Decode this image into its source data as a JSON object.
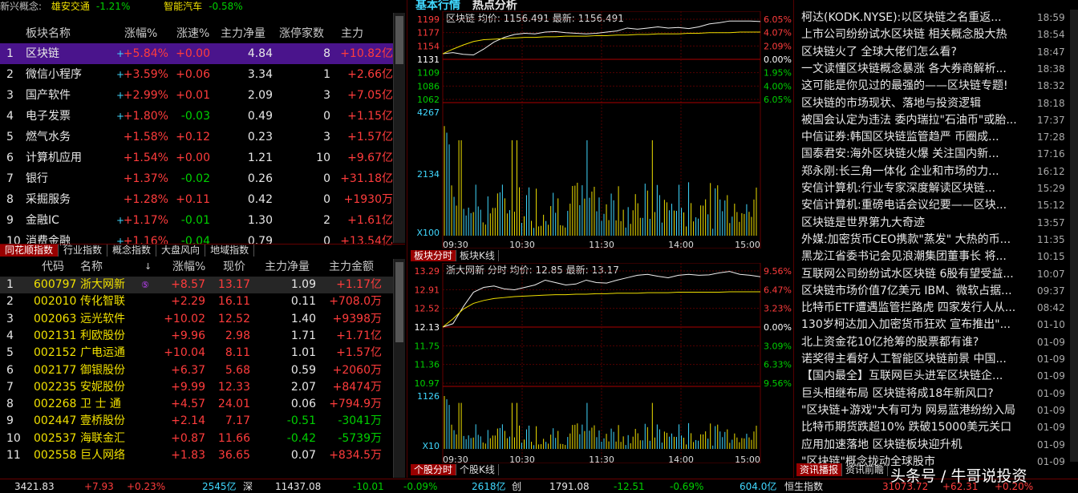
{
  "ticker": {
    "label": "新兴概念:",
    "items": [
      {
        "name": "雄安交通",
        "pct": "-1.21%"
      },
      {
        "name": "智能汽车",
        "pct": "-0.58%"
      }
    ]
  },
  "sector_table": {
    "headers": [
      "板块名称",
      "涨幅%",
      "涨速%",
      "主力净量",
      "涨停家数",
      "主力"
    ],
    "rows": [
      {
        "no": "1",
        "name": "区块链",
        "flag": "+",
        "chg": "+5.84%",
        "spd": "+0.00",
        "net": "4.84",
        "lim": "8",
        "amt": "+10.82亿"
      },
      {
        "no": "2",
        "name": "微信小程序",
        "flag": "+",
        "chg": "+3.59%",
        "spd": "+0.06",
        "net": "3.34",
        "lim": "1",
        "amt": "+2.66亿"
      },
      {
        "no": "3",
        "name": "国产软件",
        "flag": "+",
        "chg": "+2.99%",
        "spd": "+0.01",
        "net": "2.09",
        "lim": "3",
        "amt": "+7.05亿"
      },
      {
        "no": "4",
        "name": "电子发票",
        "flag": "+",
        "chg": "+1.80%",
        "spd": "-0.03",
        "net": "0.49",
        "lim": "0",
        "amt": "+1.15亿"
      },
      {
        "no": "5",
        "name": "燃气水务",
        "flag": "",
        "chg": "+1.58%",
        "spd": "+0.12",
        "net": "0.23",
        "lim": "3",
        "amt": "+1.57亿"
      },
      {
        "no": "6",
        "name": "计算机应用",
        "flag": "",
        "chg": "+1.54%",
        "spd": "+0.00",
        "net": "1.21",
        "lim": "10",
        "amt": "+9.67亿"
      },
      {
        "no": "7",
        "name": "银行",
        "flag": "",
        "chg": "+1.37%",
        "spd": "-0.02",
        "net": "0.26",
        "lim": "0",
        "amt": "+31.18亿"
      },
      {
        "no": "8",
        "name": "采掘服务",
        "flag": "",
        "chg": "+1.28%",
        "spd": "+0.11",
        "net": "0.42",
        "lim": "0",
        "amt": "+1930万"
      },
      {
        "no": "9",
        "name": "金融IC",
        "flag": "+",
        "chg": "+1.17%",
        "spd": "-0.01",
        "net": "1.30",
        "lim": "2",
        "amt": "+1.61亿"
      },
      {
        "no": "10",
        "name": "消费金融",
        "flag": "+",
        "chg": "+1.16%",
        "spd": "-0.04",
        "net": "0.79",
        "lim": "0",
        "amt": "+13.54亿"
      }
    ]
  },
  "left_tabs": [
    "同花顺指数",
    "行业指数",
    "概念指数",
    "大盘风向",
    "地域指数"
  ],
  "stock_table": {
    "headers": [
      "代码",
      "名称",
      "涨幅%",
      "现价",
      "主力净量",
      "主力金额"
    ],
    "rows": [
      {
        "no": "1",
        "code": "600797",
        "name": "浙大网新",
        "chg": "+8.57",
        "price": "13.17",
        "net": "1.09",
        "amt": "+1.17亿"
      },
      {
        "no": "2",
        "code": "002010",
        "name": "传化智联",
        "chg": "+2.29",
        "price": "16.11",
        "net": "0.11",
        "amt": "+708.0万"
      },
      {
        "no": "3",
        "code": "002063",
        "name": "远光软件",
        "chg": "+10.02",
        "price": "12.52",
        "net": "1.40",
        "amt": "+9398万"
      },
      {
        "no": "4",
        "code": "002131",
        "name": "利欧股份",
        "chg": "+9.96",
        "price": "2.98",
        "net": "1.71",
        "amt": "+1.71亿"
      },
      {
        "no": "5",
        "code": "002152",
        "name": "广电运通",
        "chg": "+10.04",
        "price": "8.11",
        "net": "1.01",
        "amt": "+1.57亿"
      },
      {
        "no": "6",
        "code": "002177",
        "name": "御银股份",
        "chg": "+6.37",
        "price": "5.68",
        "net": "0.59",
        "amt": "+2060万"
      },
      {
        "no": "7",
        "code": "002235",
        "name": "安妮股份",
        "chg": "+9.99",
        "price": "12.33",
        "net": "2.07",
        "amt": "+8474万"
      },
      {
        "no": "8",
        "code": "002268",
        "name": "卫 士 通",
        "chg": "+4.57",
        "price": "24.01",
        "net": "0.06",
        "amt": "+794.9万"
      },
      {
        "no": "9",
        "code": "002447",
        "name": "壹桥股份",
        "chg": "+2.14",
        "price": "7.17",
        "net": "-0.51",
        "amt": "-3041万"
      },
      {
        "no": "10",
        "code": "002537",
        "name": "海联金汇",
        "chg": "+0.87",
        "price": "11.66",
        "net": "-0.42",
        "amt": "-5739万"
      },
      {
        "no": "11",
        "code": "002558",
        "name": "巨人网络",
        "chg": "+1.83",
        "price": "36.65",
        "net": "0.07",
        "amt": "+834.5万"
      }
    ]
  },
  "middle": {
    "title1": "基本行情",
    "title2": "热点分析",
    "chart1": {
      "label": "区块链 均价: 1156.491 最新: 1156.491",
      "y_left": [
        "1199",
        "1177",
        "1154",
        "1131",
        "1109",
        "1086",
        "1062"
      ],
      "y_right": [
        "6.05%",
        "4.07%",
        "2.09%",
        "0.00%",
        "1.95%",
        "4.00%",
        "6.05%"
      ],
      "vol_labels": [
        "4267",
        "2134",
        "X100"
      ],
      "times": [
        "09:30",
        "10:30",
        "11:30",
        "14:00",
        "15:00"
      ],
      "tabs": [
        "板块分时",
        "板块K线"
      ],
      "price": [
        1140,
        1142,
        1139,
        1138,
        1148,
        1160,
        1168,
        1173,
        1175,
        1174,
        1177,
        1178,
        1176,
        1175,
        1174,
        1175,
        1177,
        1179,
        1184,
        1182,
        1184,
        1186,
        1184,
        1185,
        1183,
        1186,
        1191,
        1193,
        1196,
        1196,
        1196,
        1195
      ],
      "avg": [
        1140,
        1148,
        1155,
        1161,
        1164,
        1165,
        1166,
        1167,
        1168,
        1168,
        1169,
        1169,
        1170,
        1170,
        1170,
        1171,
        1171,
        1172,
        1172,
        1173,
        1173,
        1174,
        1174,
        1174,
        1175,
        1175,
        1176,
        1176,
        1176,
        1177,
        1177,
        1177
      ]
    },
    "chart2": {
      "label": "浙大网新 分时 均价: 12.85 最新: 13.17",
      "y_left": [
        "13.29",
        "12.91",
        "12.52",
        "12.13",
        "11.75",
        "11.36",
        "10.97"
      ],
      "y_right": [
        "9.56%",
        "6.47%",
        "3.23%",
        "0.00%",
        "3.09%",
        "6.33%",
        "9.56%"
      ],
      "vol_labels": [
        "1126",
        "X10"
      ],
      "times": [
        "09:30",
        "10:30",
        "11:30",
        "14:00",
        "15:00"
      ],
      "tabs": [
        "个股分时",
        "个股K线"
      ],
      "price": [
        12.13,
        12.2,
        12.55,
        12.85,
        12.95,
        12.98,
        12.92,
        12.9,
        12.95,
        13.0,
        13.1,
        13.05,
        13.0,
        13.02,
        13.1,
        13.05,
        13.04,
        13.1,
        13.15,
        13.2,
        13.22,
        13.18,
        13.15,
        13.2,
        13.22,
        13.2,
        13.21,
        13.25,
        13.28,
        13.22,
        13.2,
        13.17
      ],
      "avg": [
        12.13,
        12.3,
        12.5,
        12.62,
        12.68,
        12.72,
        12.74,
        12.76,
        12.77,
        12.78,
        12.79,
        12.8,
        12.8,
        12.81,
        12.81,
        12.82,
        12.82,
        12.83,
        12.83,
        12.83,
        12.84,
        12.84,
        12.84,
        12.85,
        12.85,
        12.85,
        12.85,
        12.85,
        12.86,
        12.86,
        12.86,
        12.86
      ]
    }
  },
  "news": {
    "items": [
      {
        "t": "柯达(KODK.NYSE):以区块链之名重返...",
        "tm": "18:59"
      },
      {
        "t": "上市公司纷纷试水区块链 相关概念股大热",
        "tm": "18:54"
      },
      {
        "t": "区块链火了 全球大佬们怎么看?",
        "tm": "18:47"
      },
      {
        "t": "一文读懂区块链概念暴涨 各大券商解析...",
        "tm": "18:38"
      },
      {
        "t": "这可能是你见过的最强的——区块链专题!",
        "tm": "18:32"
      },
      {
        "t": "区块链的市场现状、落地与投资逻辑",
        "tm": "18:18"
      },
      {
        "t": "被国会认定为违法 委内瑞拉\"石油币\"或胎...",
        "tm": "17:37"
      },
      {
        "t": "中信证券:韩国区块链监管趋严 币圈成...",
        "tm": "17:28"
      },
      {
        "t": "国泰君安:海外区块链火爆 关注国内新...",
        "tm": "17:16"
      },
      {
        "t": "郑永刚:长三角一体化 企业和市场的力...",
        "tm": "16:12"
      },
      {
        "t": "安信计算机:行业专家深度解读区块链...",
        "tm": "15:29"
      },
      {
        "t": "安信计算机:重磅电话会议纪要——区块...",
        "tm": "15:12"
      },
      {
        "t": "区块链是世界第九大奇迹",
        "tm": "13:57"
      },
      {
        "t": "外媒:加密货币CEO携款\"蒸发\" 大热的币...",
        "tm": "11:35"
      },
      {
        "t": "黑龙江省委书记会见浪潮集团董事长 将...",
        "tm": "10:15"
      },
      {
        "t": "互联网公司纷纷试水区块链 6股有望受益...",
        "tm": "10:07"
      },
      {
        "t": "区块链市场价值7亿美元 IBM、微软占据...",
        "tm": "09:37"
      },
      {
        "t": "比特币ETF遭遇监管拦路虎 四家发行人从...",
        "tm": "08:42"
      },
      {
        "t": "130岁柯达加入加密货币狂欢 宣布推出\"...",
        "tm": "01-10"
      },
      {
        "t": "北上资金花10亿抢筹的股票都有谁?",
        "tm": "01-09"
      },
      {
        "t": "诺奖得主看好人工智能区块链前景 中国...",
        "tm": "01-09"
      },
      {
        "t": "【国内最全】互联网巨头进军区块链企...",
        "tm": "01-09"
      },
      {
        "t": "巨头相继布局 区块链将成18年新风口?",
        "tm": "01-09"
      },
      {
        "t": "\"区块链+游戏\"大有可为 网易蓝港纷纷入局",
        "tm": "01-09"
      },
      {
        "t": "比特币期货跌超10% 跌破15000美元关口",
        "tm": "01-09"
      },
      {
        "t": "应用加速落地 区块链板块迎升机",
        "tm": "01-09"
      },
      {
        "t": "\"区块链\"概念拢动全球股市",
        "tm": "01-09"
      }
    ],
    "tabs": [
      "资讯播报",
      "资讯前瞻"
    ]
  },
  "status": {
    "sh_idx": "3421.83",
    "sh_chg": "+7.93",
    "sh_pct": "+0.23%",
    "sh_amt": "2545亿",
    "sh_label": "深",
    "sz_idx": "11437.08",
    "sz_chg": "-10.01",
    "sz_pct": "-0.09%",
    "sz_amt": "2618亿",
    "sz_label": "创",
    "cy_idx": "1791.08",
    "cy_chg": "-12.51",
    "cy_pct": "-0.69%",
    "cy_amt": "604.0亿",
    "hs_label": "恒生指数",
    "hs_idx": "31073.72",
    "hs_chg": "+62.31",
    "hs_pct": "+0.20%"
  },
  "watermark": "头条号 / 牛哥说投资",
  "colors": {
    "up": "#ff3c3c",
    "down": "#00d000",
    "accent": "#4a148c"
  }
}
